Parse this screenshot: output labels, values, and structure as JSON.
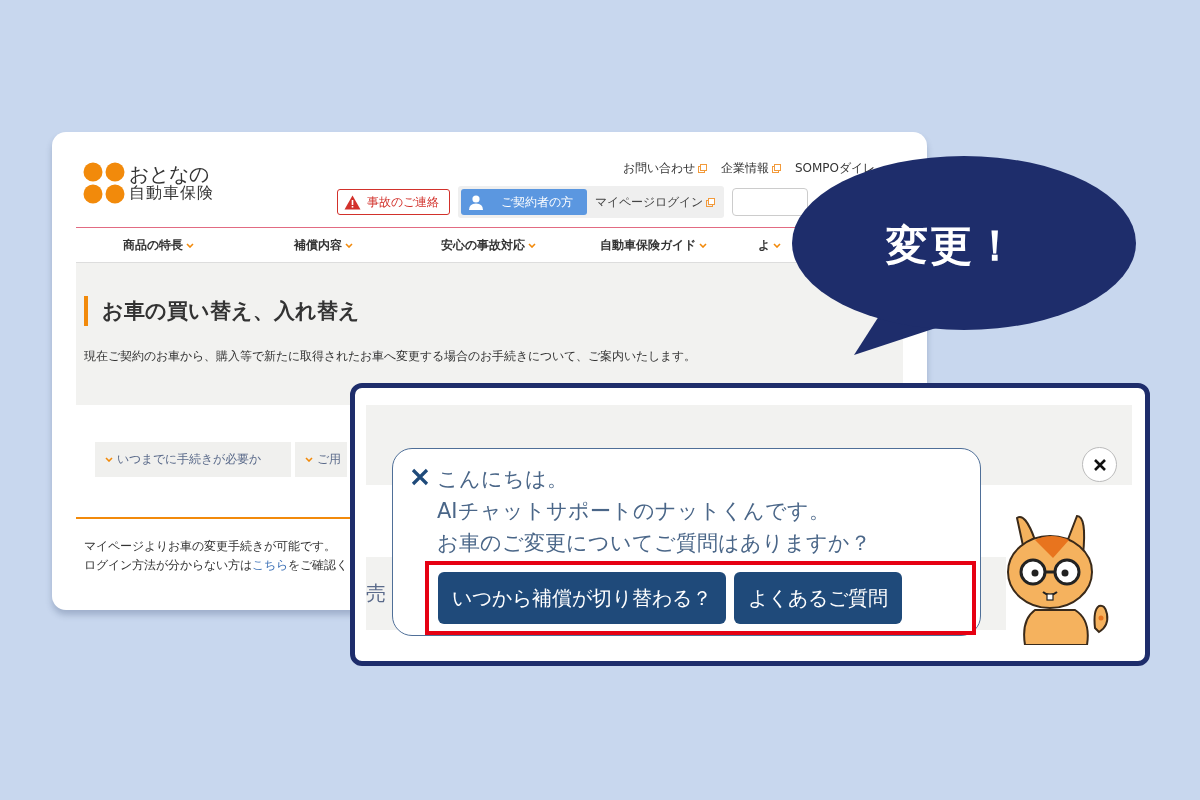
{
  "site": {
    "logo": {
      "line1": "おとなの",
      "line2": "自動車保険"
    },
    "utility_links": [
      {
        "label": "お問い合わせ",
        "external": true
      },
      {
        "label": "企業情報",
        "external": true
      },
      {
        "label": "SOMPOダイレ",
        "external": false
      }
    ],
    "accident_button": "事故のご連絡",
    "member_tab": "ご契約者の方",
    "mypage_login": "マイページログイン",
    "nav": [
      "商品の特長",
      "補償内容",
      "安心の事故対応",
      "自動車保険ガイド",
      "よ"
    ],
    "page_title": "お車の買い替え、入れ替え",
    "description": "現在ご契約のお車から、購入等で新たに取得されたお車へ変更する場合のお手続きについて、ご案内いたします。",
    "anchor_links": [
      "いつまでに手続きが必要か",
      "ご用"
    ],
    "note_line1": "マイページよりお車の変更手続きが可能です。",
    "note_line2": {
      "before": "ログイン方法が分からない方は",
      "link": "こちら",
      "after": "をご確認く"
    }
  },
  "callout": {
    "text": "変更！"
  },
  "chat": {
    "background_text": "売",
    "messages": [
      "こんにちは。",
      "AIチャットサポートのナットくんです。",
      "お車のご変更についてご質問はありますか？"
    ],
    "buttons_highlighted": true,
    "buttons": [
      "いつから補償が切り替わる？",
      "よくあるご質問"
    ]
  }
}
